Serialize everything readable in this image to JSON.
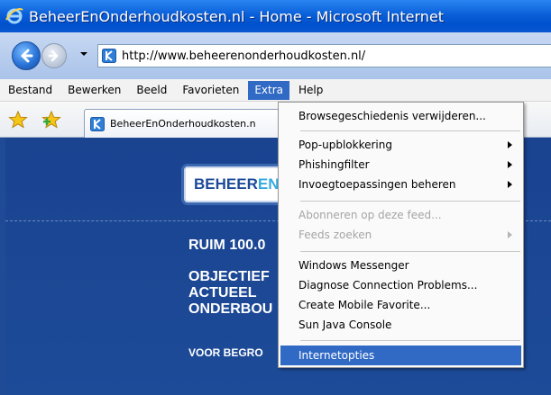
{
  "window": {
    "title": "BeheerEnOnderhoudkosten.nl - Home - Microsoft Internet"
  },
  "address_bar": {
    "url": "http://www.beheerenonderhoudkosten.nl/"
  },
  "menubar": {
    "items": [
      {
        "label": "Bestand"
      },
      {
        "label": "Bewerken"
      },
      {
        "label": "Beeld"
      },
      {
        "label": "Favorieten"
      },
      {
        "label": "Extra",
        "active": true
      },
      {
        "label": "Help"
      }
    ]
  },
  "tab": {
    "label": "BeheerEnOnderhoudkosten.n"
  },
  "page": {
    "logo_part1": "BEHEER",
    "logo_part2": "EN",
    "headline": "RUIM 100.0",
    "sub_lines": [
      "OBJECTIEF",
      "ACTUEEL",
      "ONDERBOU"
    ],
    "footer_text": "VOOR BEGRO"
  },
  "extra_menu": {
    "items": [
      {
        "label": "Browsegeschiedenis verwijderen...",
        "enabled": true,
        "submenu": false
      },
      {
        "label": "Pop-upblokkering",
        "enabled": true,
        "submenu": true
      },
      {
        "label": "Phishingfilter",
        "enabled": true,
        "submenu": true
      },
      {
        "label": "Invoegtoepassingen beheren",
        "enabled": true,
        "submenu": true
      },
      {
        "label": "Abonneren op deze feed...",
        "enabled": false,
        "submenu": false
      },
      {
        "label": "Feeds zoeken",
        "enabled": false,
        "submenu": true
      },
      {
        "label": "Windows Messenger",
        "enabled": true,
        "submenu": false
      },
      {
        "label": "Diagnose Connection Problems...",
        "enabled": true,
        "submenu": false
      },
      {
        "label": "Create Mobile Favorite...",
        "enabled": true,
        "submenu": false
      },
      {
        "label": "Sun Java Console",
        "enabled": true,
        "submenu": false
      },
      {
        "label": "Internetopties",
        "enabled": true,
        "submenu": false,
        "selected": true
      }
    ]
  },
  "colors": {
    "titlebar": "#0a5fd8",
    "menu_highlight": "#316ac5",
    "page_background": "#1d4b98"
  }
}
